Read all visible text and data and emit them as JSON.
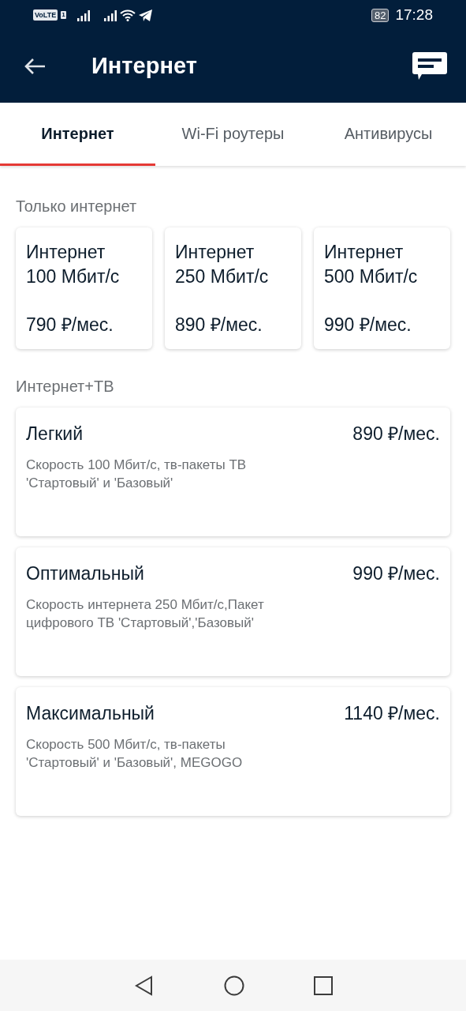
{
  "status_bar": {
    "network_badge": "VoLTE",
    "sim": "1",
    "battery": "82",
    "time": "17:28"
  },
  "app_bar": {
    "title": "Интернет"
  },
  "tabs": [
    {
      "label": "Интернет",
      "selected": true
    },
    {
      "label": "Wi-Fi роутеры",
      "selected": false
    },
    {
      "label": "Антивирусы",
      "selected": false
    }
  ],
  "sections": [
    {
      "title": "Только интернет",
      "kind": "tiles",
      "plans": [
        {
          "name": "Интернет 100 Мбит/с",
          "price": "790 ₽/мес."
        },
        {
          "name": "Интернет 250 Мбит/с",
          "price": "890 ₽/мес."
        },
        {
          "name": "Интернет 500 Мбит/с",
          "price": "990 ₽/мес."
        }
      ]
    },
    {
      "title": "Интернет+ТВ",
      "kind": "rows",
      "plans": [
        {
          "name": "Легкий",
          "price": "890 ₽/мес.",
          "description": "Скорость 100 Мбит/с, тв-пакеты ТВ 'Стартовый' и 'Базовый'"
        },
        {
          "name": "Оптимальный",
          "price": "990 ₽/мес.",
          "description": "Скорость интернета 250 Мбит/с,Пакет цифрового ТВ 'Стартовый','Базовый'"
        },
        {
          "name": "Максимальный",
          "price": "1140 ₽/мес.",
          "description": "Скорость 500 Мбит/с, тв-пакеты 'Стартовый' и 'Базовый', MEGOGO"
        }
      ]
    }
  ]
}
